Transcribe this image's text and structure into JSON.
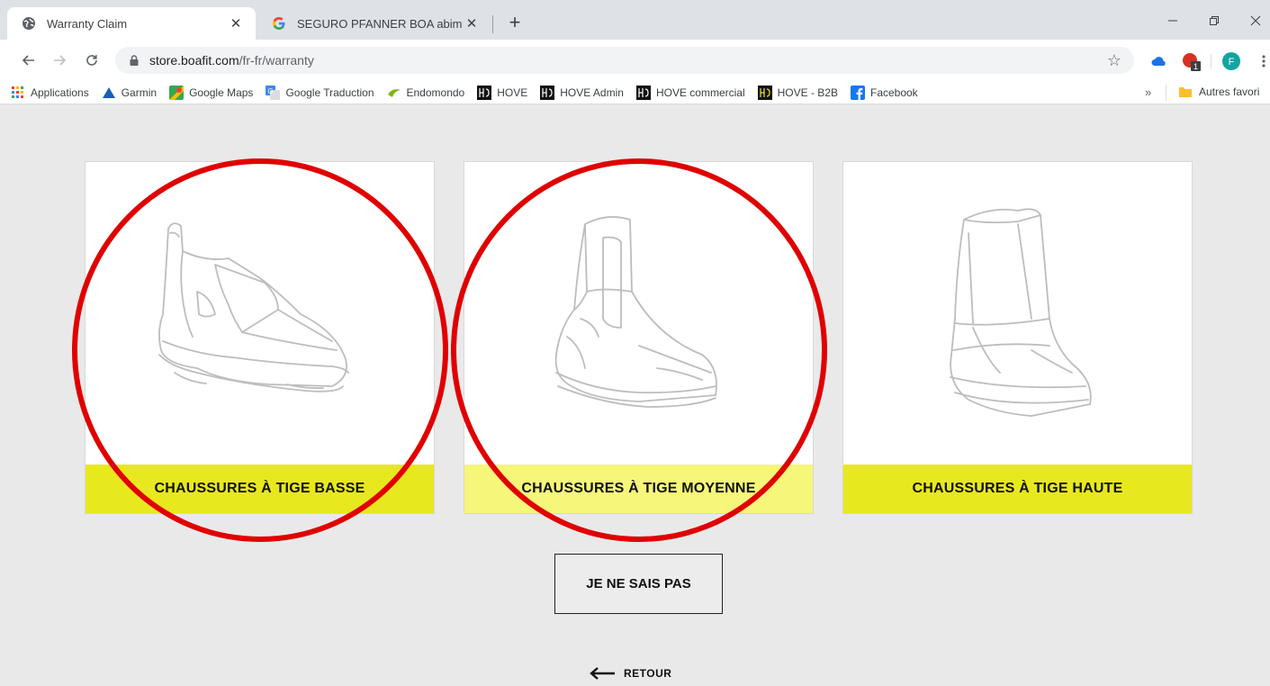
{
  "browser": {
    "tabs": [
      {
        "title": "Warranty Claim",
        "close": "✕"
      },
      {
        "title": "SEGURO PFANNER BOA abimé -",
        "close": "✕"
      }
    ],
    "new_tab": "+",
    "url_host": "store.boafit.com",
    "url_path": "/fr-fr/warranty",
    "profile_letter": "F",
    "extension_badge": "1"
  },
  "bookmarks": {
    "items": [
      "Applications",
      "Garmin",
      "Google Maps",
      "Google Traduction",
      "Endomondo",
      "HOVE",
      "HOVE Admin",
      "HOVE commercial",
      "HOVE - B2B",
      "Facebook"
    ],
    "more": "»",
    "other": "Autres favori"
  },
  "page": {
    "cards": [
      {
        "label": "CHAUSSURES À TIGE BASSE"
      },
      {
        "label": "CHAUSSURES À TIGE MOYENNE"
      },
      {
        "label": "CHAUSSURES À TIGE HAUTE"
      }
    ],
    "dont_know": "JE NE SAIS PAS",
    "back": "RETOUR"
  },
  "colors": {
    "accent_yellow": "#e8e81f",
    "hover_yellow": "#f6f67a",
    "annotation_red": "#e00000"
  }
}
